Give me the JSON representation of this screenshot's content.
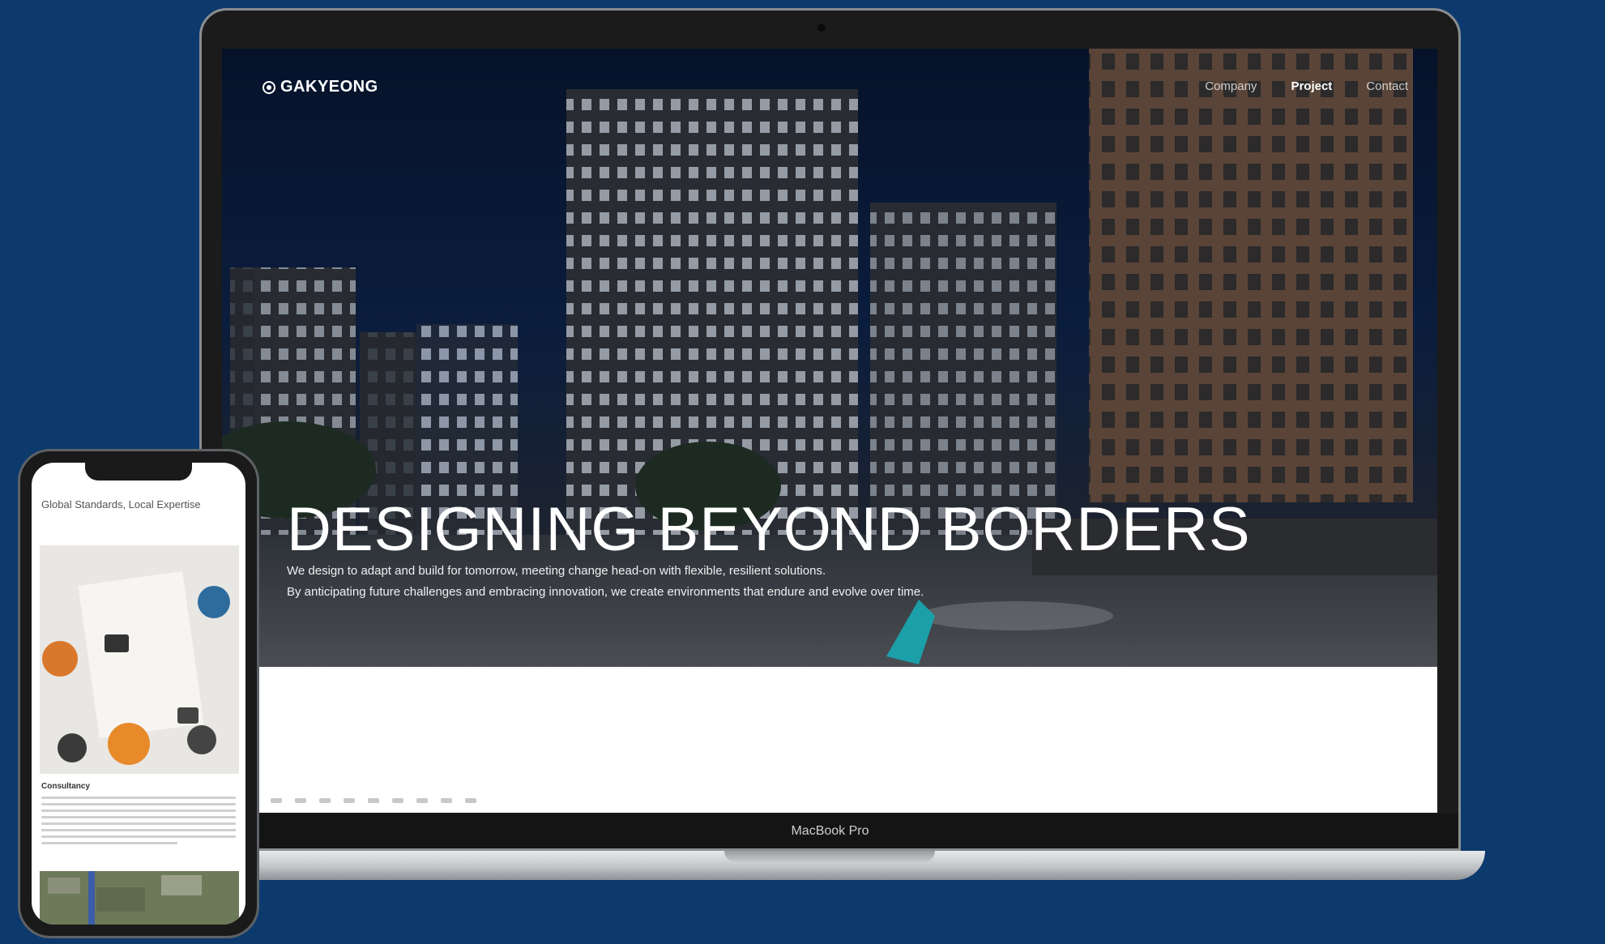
{
  "laptop": {
    "model_label": "MacBook Pro",
    "site": {
      "logo_text": "GAKYEONG",
      "nav": [
        {
          "label": "Company",
          "active": false
        },
        {
          "label": "Project",
          "active": true
        },
        {
          "label": "Contact",
          "active": false
        }
      ],
      "hero": {
        "title": "DESIGNING BEYOND BORDERS",
        "subtitle_lines": [
          "We design to adapt and build for tomorrow, meeting change head-on with flexible, resilient solutions.",
          "By anticipating future challenges and embracing innovation, we create environments that endure and evolve over time."
        ]
      }
    }
  },
  "phone": {
    "heading": "Global Standards, Local Expertise",
    "section_title": "Consultancy"
  },
  "colors": {
    "background": "#0d3a6d",
    "hero_text": "#ffffff"
  }
}
